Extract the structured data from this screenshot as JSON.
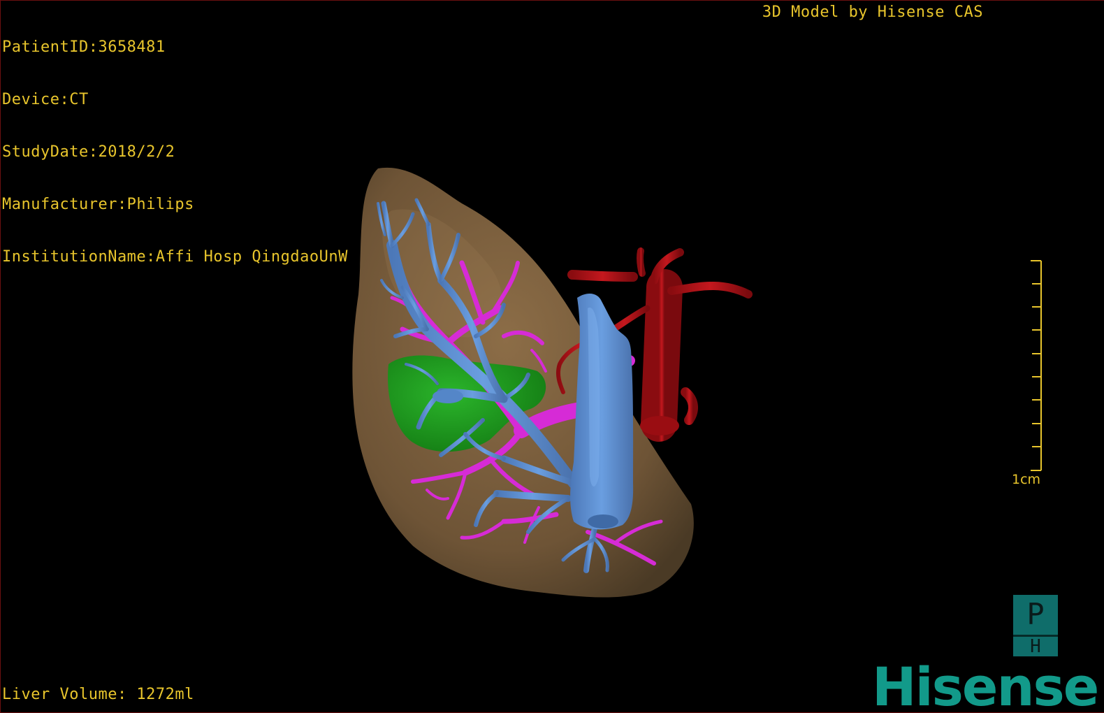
{
  "patient_info": {
    "patient_id": "PatientID:3658481",
    "device": "Device:CT",
    "study_date": "StudyDate:2018/2/2",
    "manufacturer": "Manufacturer:Philips",
    "institution": "InstitutionName:Affi Hosp QingdaoUnW"
  },
  "model_credit": "3D Model by Hisense CAS",
  "liver_volume": "Liver Volume: 1272ml",
  "scale": {
    "label": "1cm"
  },
  "orientation": {
    "top_letter": "P",
    "bottom_letter": "H"
  },
  "brand": "Hisense",
  "colors": {
    "overlay_text": "#e8c52c",
    "liver": "#7a5e3c",
    "hepatic_vein": "#5b8fd6",
    "portal_vein": "#d426d4",
    "artery": "#b8141a",
    "gallbladder": "#1e9b1e",
    "brand": "#129a8a"
  }
}
